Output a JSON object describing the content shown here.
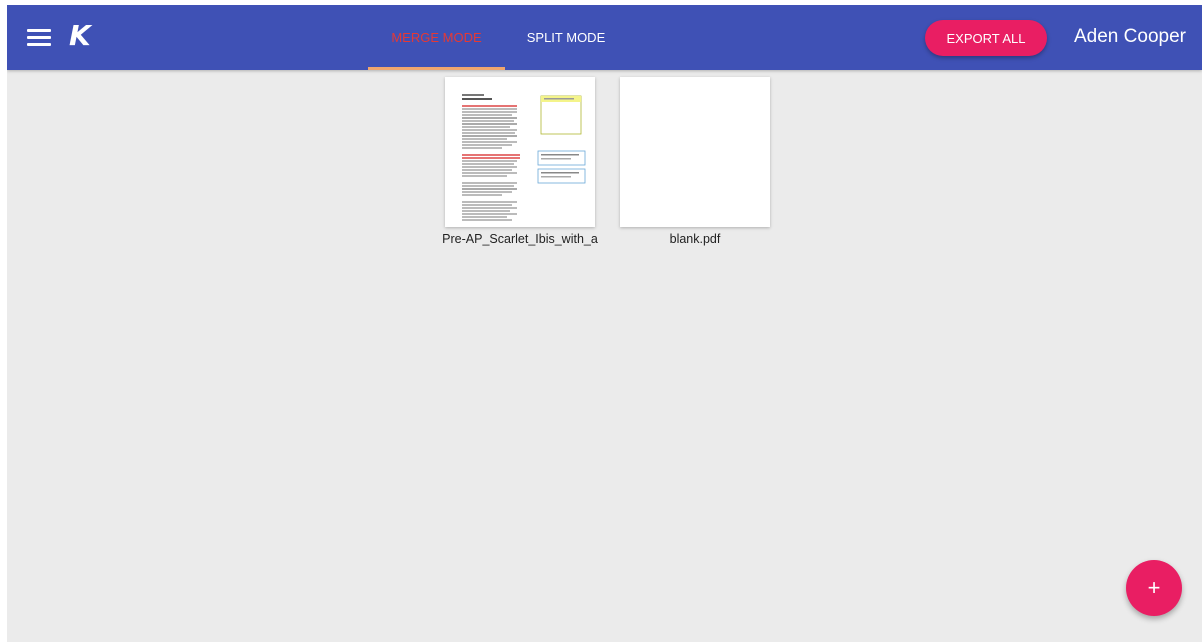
{
  "header": {
    "logo": "K",
    "tabs": [
      {
        "label": "MERGE MODE",
        "active": true
      },
      {
        "label": "SPLIT MODE",
        "active": false
      }
    ],
    "export_label": "EXPORT ALL",
    "user_name": "Aden Cooper"
  },
  "files": [
    {
      "name": "Pre-AP_Scarlet_Ibis_with_a"
    },
    {
      "name": "blank.pdf"
    }
  ],
  "fab": {
    "icon": "plus-icon",
    "symbol": "+"
  },
  "colors": {
    "app_bar": "#3f51b5",
    "accent": "#e91e63",
    "active_tab_text": "#e53935",
    "tab_indicator": "#f0a66e",
    "background": "#ebebeb"
  }
}
